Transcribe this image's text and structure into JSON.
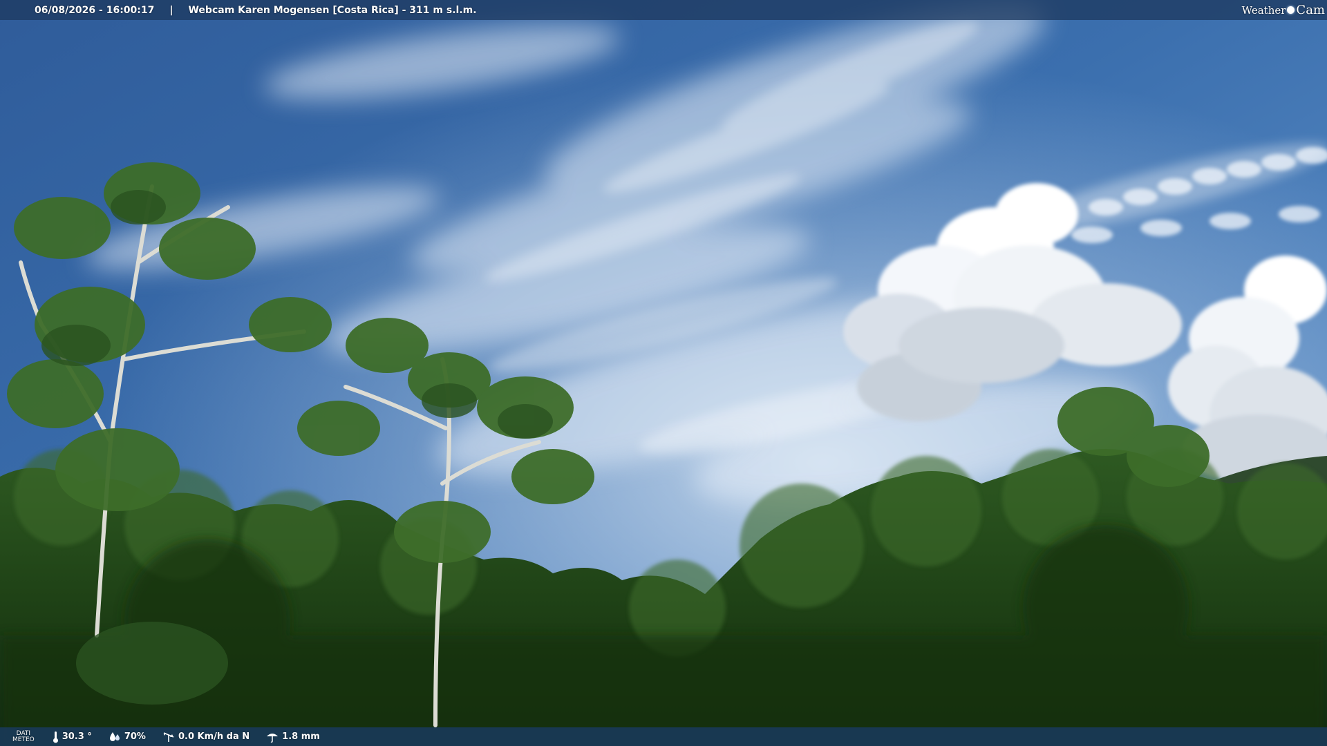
{
  "topbar": {
    "datetime": "06/08/2026 - 16:00:17",
    "separator": "|",
    "webcam_title": "Webcam Karen Mogensen [Costa Rica]  - 311 m s.l.m."
  },
  "brand": {
    "word1": "Weather",
    "word2": "Cam",
    "icon": "sun-icon"
  },
  "weather": {
    "label_line1": "DATI",
    "label_line2": "METEO",
    "temperature": "30.3 °",
    "humidity": "70%",
    "wind": "0.0 Km/h da N",
    "rain": "1.8 mm",
    "icons": {
      "temperature": "thermometer-icon",
      "humidity": "droplet-icon",
      "wind": "wind-vane-icon",
      "rain": "rain-icon"
    }
  }
}
